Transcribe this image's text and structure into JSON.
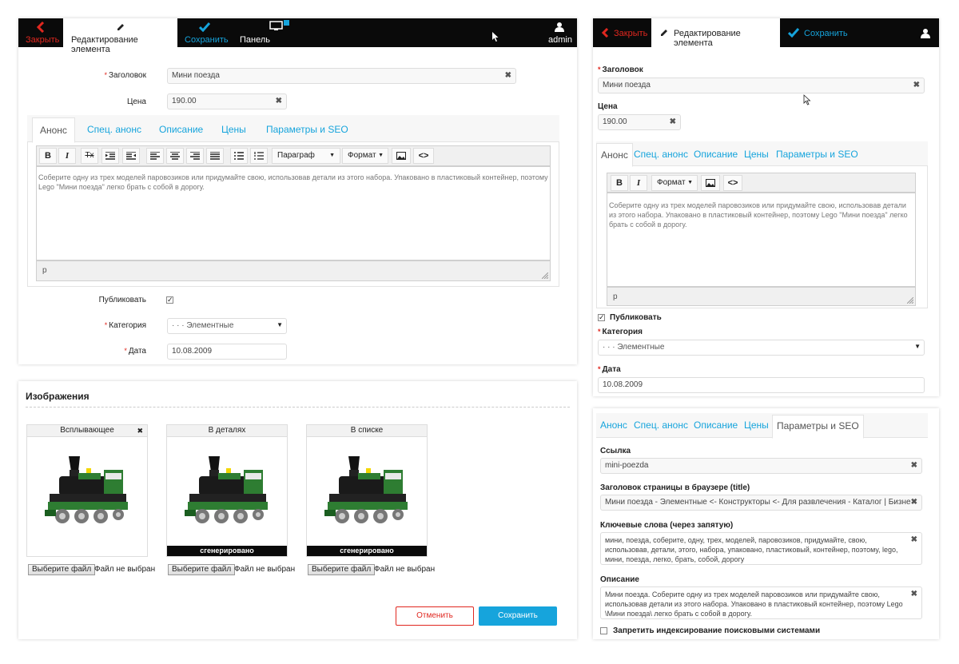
{
  "left": {
    "topbar": {
      "close_label": "Закрыть",
      "edit_label": "Редактирование элемента",
      "save_label": "Сохранить",
      "dashboard_label": "Панель управления",
      "user_label": "admin"
    },
    "form": {
      "title_label": "Заголовок",
      "title_value": "Мини поезда",
      "price_label": "Цена",
      "price_value": "190.00",
      "tabs": [
        "Анонс",
        "Спец. анонс",
        "Описание",
        "Цены",
        "Параметры и SEO"
      ],
      "toolbar": {
        "bold": "B",
        "italic": "I",
        "clear_format": "Tx",
        "paragraph_select": "Параграф",
        "format_select": "Формат"
      },
      "editor_text": "Соберите одну из трех моделей паровозиков или придумайте свою, использовав детали из этого набора. Упаковано в пластиковый контейнер, поэтому Lego \"Мини поезда\" легко брать с собой в дорогу.",
      "status_path": "p",
      "publish_label": "Публиковать",
      "category_label": "Категория",
      "category_value": "· · · Элементные",
      "date_label": "Дата",
      "date_value": "10.08.2009"
    },
    "images": {
      "heading": "Изображения",
      "boxes": [
        {
          "title": "Всплывающее",
          "footer": ""
        },
        {
          "title": "В деталях",
          "footer": "сгенерировано"
        },
        {
          "title": "В списке",
          "footer": "сгенерировано"
        }
      ],
      "file_button": "Выберите файл",
      "file_status": "Файл не выбран",
      "cancel_label": "Отменить",
      "save_label": "Сохранить"
    }
  },
  "right": {
    "topbar": {
      "close_label": "Закрыть",
      "edit_label": "Редактирование элемента",
      "save_label": "Сохранить"
    },
    "form": {
      "title_label": "Заголовок",
      "title_value": "Мини поезда",
      "price_label": "Цена",
      "price_value": "190.00",
      "tabs": [
        "Анонс",
        "Спец. анонс",
        "Описание",
        "Цены",
        "Параметры и SEO"
      ],
      "format_select": "Формат",
      "editor_text": "Соберите одну из трех моделей паровозиков или придумайте свою, использовав детали из этого набора. Упаковано в пластиковый контейнер, поэтому Lego \"Мини поезда\" легко брать с собой в дорогу.",
      "status_path": "p",
      "publish_label": "Публиковать",
      "category_label": "Категория",
      "category_value": "· · · Элементные",
      "date_label": "Дата",
      "date_value": "10.08.2009"
    },
    "seo": {
      "tabs": [
        "Анонс",
        "Спец. анонс",
        "Описание",
        "Цены",
        "Параметры и SEO"
      ],
      "link_label": "Ссылка",
      "link_value": "mini-poezda",
      "page_title_label": "Заголовок страницы в браузере (title)",
      "page_title_value": "Мини поезда - Элементные <- Конструкторы <- Для развлечения - Каталог  | Бизнес",
      "keywords_label": "Ключевые слова (через запятую)",
      "keywords_value": "мини, поезда, соберите, одну, трех, моделей, паровозиков, придумайте, свою, использовав, детали, этого, набора, упаковано, пластиковый, контейнер, поэтому, lego, мини, поезда, легко, брать, собой, дорогу",
      "description_label": "Описание",
      "description_value": "Мини поезда. Соберите одну из трех моделей паровозиков или придумайте свою, использовав детали из этого набора. Упаковано в пластиковый контейнер, поэтому Lego \\Мини поезда\\ легко брать с собой в дорогу.",
      "noindex_label": "Запретить индексирование поисковыми системами"
    }
  },
  "colors": {
    "accent": "#16a4dc",
    "danger": "#e0271f",
    "topbar": "#0a0a0a"
  }
}
